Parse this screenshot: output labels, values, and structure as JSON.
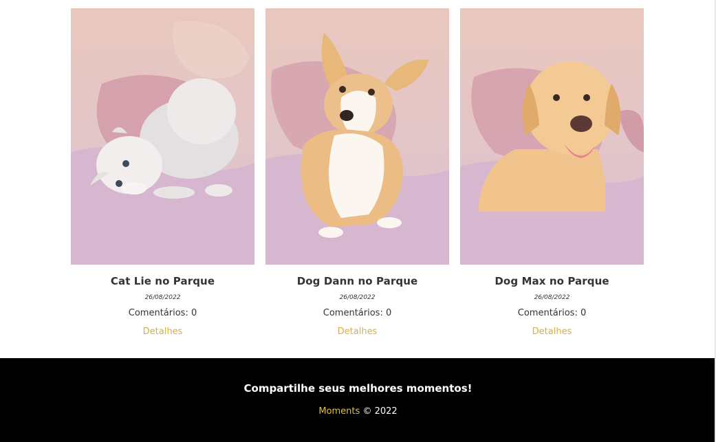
{
  "moments": [
    {
      "title": "Cat Lie no Parque",
      "date": "26/08/2022",
      "comments": "Comentários: 0",
      "link": "Detalhes",
      "image_subject": "kitten-photo"
    },
    {
      "title": "Dog Dann no Parque",
      "date": "26/08/2022",
      "comments": "Comentários: 0",
      "link": "Detalhes",
      "image_subject": "corgi-photo"
    },
    {
      "title": "Dog Max no Parque",
      "date": "26/08/2022",
      "comments": "Comentários: 0",
      "link": "Detalhes",
      "image_subject": "labrador-photo"
    }
  ],
  "footer": {
    "tagline": "Compartilhe seus melhores momentos!",
    "brand": "Moments",
    "copyright": "© 2022"
  },
  "colors": {
    "link": "#d4b048",
    "brand": "#e1c341",
    "footer_bg": "#000000"
  }
}
